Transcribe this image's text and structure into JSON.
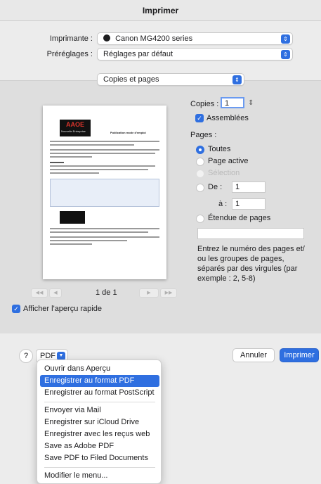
{
  "window": {
    "title": "Imprimer"
  },
  "printer": {
    "label": "Imprimante :",
    "value": "Canon MG4200 series"
  },
  "presets": {
    "label": "Préréglages :",
    "value": "Réglages par défaut"
  },
  "section": {
    "value": "Copies et pages"
  },
  "preview": {
    "page_indicator": "1 de 1",
    "nav": {
      "first": "◀◀",
      "prev": "◀",
      "next": "▶",
      "last": "▶▶"
    },
    "quick_preview_label": "Afficher l'aperçu rapide",
    "quick_preview_checked": true
  },
  "copies": {
    "label": "Copies :",
    "value": "1",
    "collated_label": "Assemblées",
    "collated_checked": true
  },
  "pages": {
    "label": "Pages :",
    "options": [
      {
        "label": "Toutes",
        "selected": true,
        "enabled": true
      },
      {
        "label": "Page active",
        "selected": false,
        "enabled": true
      },
      {
        "label": "Sélection",
        "selected": false,
        "enabled": false
      }
    ],
    "range_from_label": "De :",
    "range_from_value": "1",
    "range_to_label": "à :",
    "range_to_value": "1",
    "range_option_label": "Étendue de pages",
    "range_input_value": "",
    "hint": [
      "Entrez le numéro des pages et/",
      "ou les groupes de pages,",
      "séparés par des virgules (par",
      "exemple : 2, 5-8)"
    ]
  },
  "footer": {
    "help_label": "?",
    "pdf_label": "PDF",
    "cancel_label": "Annuler",
    "print_label": "Imprimer"
  },
  "pdf_menu": {
    "items": [
      "Ouvrir dans Aperçu",
      "Enregistrer au format PDF",
      "Enregistrer au format PostScript",
      "Envoyer via Mail",
      "Enregistrer sur iCloud Drive",
      "Enregistrer avec les reçus web",
      "Save as Adobe PDF",
      "Save PDF to Filed Documents",
      "Modifier le menu..."
    ],
    "selected_index": 1
  },
  "thumbnail": {
    "logo_text": "AAOE",
    "logo_subtext": "Nouvelle Entreprise",
    "heading": "Publication mode d'emploi"
  },
  "colors": {
    "accent": "#2f6fe0",
    "window_bg": "#ececec",
    "preview_bg": "#dedede"
  },
  "icons": {
    "stepper": "chevron-updown-icon",
    "check": "checkmark-icon",
    "printer": "printer-icon"
  }
}
